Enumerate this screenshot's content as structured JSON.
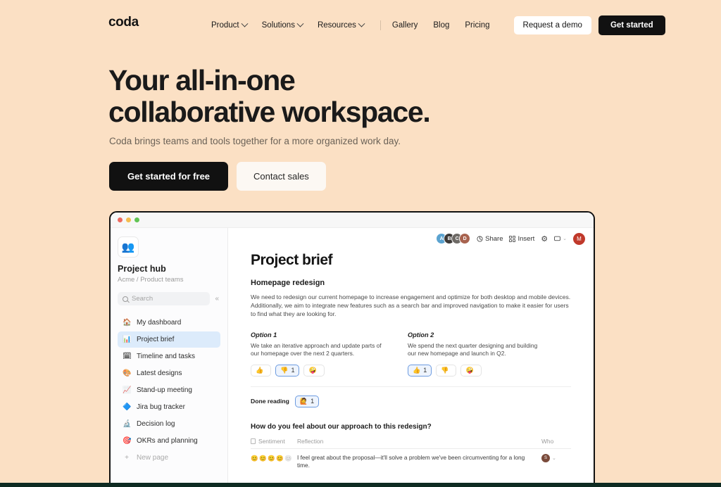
{
  "theme": {
    "page_bg": "#FBE0C4",
    "accent_dark": "#111111",
    "strip_green": "#0E2B22",
    "highlight_blue": "#DCEBFB"
  },
  "nav": {
    "logo": "coda",
    "menus": [
      {
        "label": "Product",
        "icon": "chevron-down-icon"
      },
      {
        "label": "Solutions",
        "icon": "chevron-down-icon"
      },
      {
        "label": "Resources",
        "icon": "chevron-down-icon"
      }
    ],
    "links": [
      "Gallery",
      "Blog",
      "Pricing"
    ],
    "demo_button": "Request a demo",
    "started_button": "Get started"
  },
  "hero": {
    "title_line1": "Your all-in-one",
    "title_line2": "collaborative workspace.",
    "subtitle": "Coda brings teams and tools together for a more organized work day.",
    "cta_primary": "Get started for free",
    "cta_secondary": "Contact sales"
  },
  "app": {
    "sidebar": {
      "workspace_icon": "👥",
      "title": "Project hub",
      "breadcrumb": "Acme / Product teams",
      "search_placeholder": "Search",
      "collapse_icon": "«",
      "items": [
        {
          "label": "My dashboard",
          "emoji": "🏠",
          "active": false
        },
        {
          "label": "Project brief",
          "emoji": "📊",
          "active": true
        },
        {
          "label": "Timeline and tasks",
          "emoji": "🗓",
          "active": false
        },
        {
          "label": "Latest designs",
          "emoji": "🎨",
          "active": false
        },
        {
          "label": "Stand-up meeting",
          "emoji": "📈",
          "active": false
        },
        {
          "label": "Jira bug tracker",
          "emoji": "🔷",
          "active": false
        },
        {
          "label": "Decision log",
          "emoji": "🔬",
          "active": false
        },
        {
          "label": "OKRs and planning",
          "emoji": "🎯",
          "active": false
        }
      ],
      "new_page": "New page",
      "new_page_icon": "+"
    },
    "topbar": {
      "share_label": "Share",
      "insert_label": "Insert",
      "share_icon": "share-icon",
      "insert_icon": "grid-icon",
      "settings_icon": "⚙",
      "comment_icon": "💬",
      "comment_caret": "⌄",
      "collaborators": [
        {
          "initial": "A",
          "color": "#5BA3D0"
        },
        {
          "initial": "B",
          "color": "#3E3A38"
        },
        {
          "initial": "C",
          "color": "#6E6A66"
        },
        {
          "initial": "D",
          "color": "#A8634F"
        }
      ],
      "current_user": {
        "initial": "M",
        "color": "#C0392B"
      }
    },
    "doc": {
      "title": "Project brief",
      "section_heading": "Homepage redesign",
      "intro": "We need to redesign our current homepage to increase engagement and optimize for both desktop and mobile devices. Additionally, we aim to integrate new features such as a search bar and improved navigation to make it easier for users to find what they are looking for.",
      "options": [
        {
          "title": "Option 1",
          "text": "We take an iterative approach and update parts of our homepage over the next 2 quarters.",
          "reactions": [
            {
              "emoji": "👍",
              "count": "",
              "selected": false
            },
            {
              "emoji": "👎",
              "count": "1",
              "selected": true
            },
            {
              "emoji": "🤪",
              "count": "",
              "selected": false
            }
          ]
        },
        {
          "title": "Option 2",
          "text": "We spend the next quarter designing and building our new homepage and launch in Q2.",
          "reactions": [
            {
              "emoji": "👍",
              "count": "1",
              "selected": true
            },
            {
              "emoji": "👎",
              "count": "",
              "selected": false
            },
            {
              "emoji": "🤪",
              "count": "",
              "selected": false
            }
          ]
        }
      ],
      "done_reading_label": "Done reading",
      "done_reading_chip": {
        "emoji": "🙋",
        "count": "1",
        "selected": true
      },
      "question": "How do you feel about our approach to this redesign?",
      "table": {
        "columns": [
          "Sentiment",
          "Reflection",
          "Who"
        ],
        "rows": [
          {
            "sentiment_filled": 4,
            "sentiment_total": 5,
            "sentiment_emoji": "😊",
            "reflection": "I feel great about the proposal—it'll solve a problem we've been circumventing for a long time.",
            "who_initial": "S",
            "who_caret": "⌄"
          }
        ]
      }
    }
  }
}
